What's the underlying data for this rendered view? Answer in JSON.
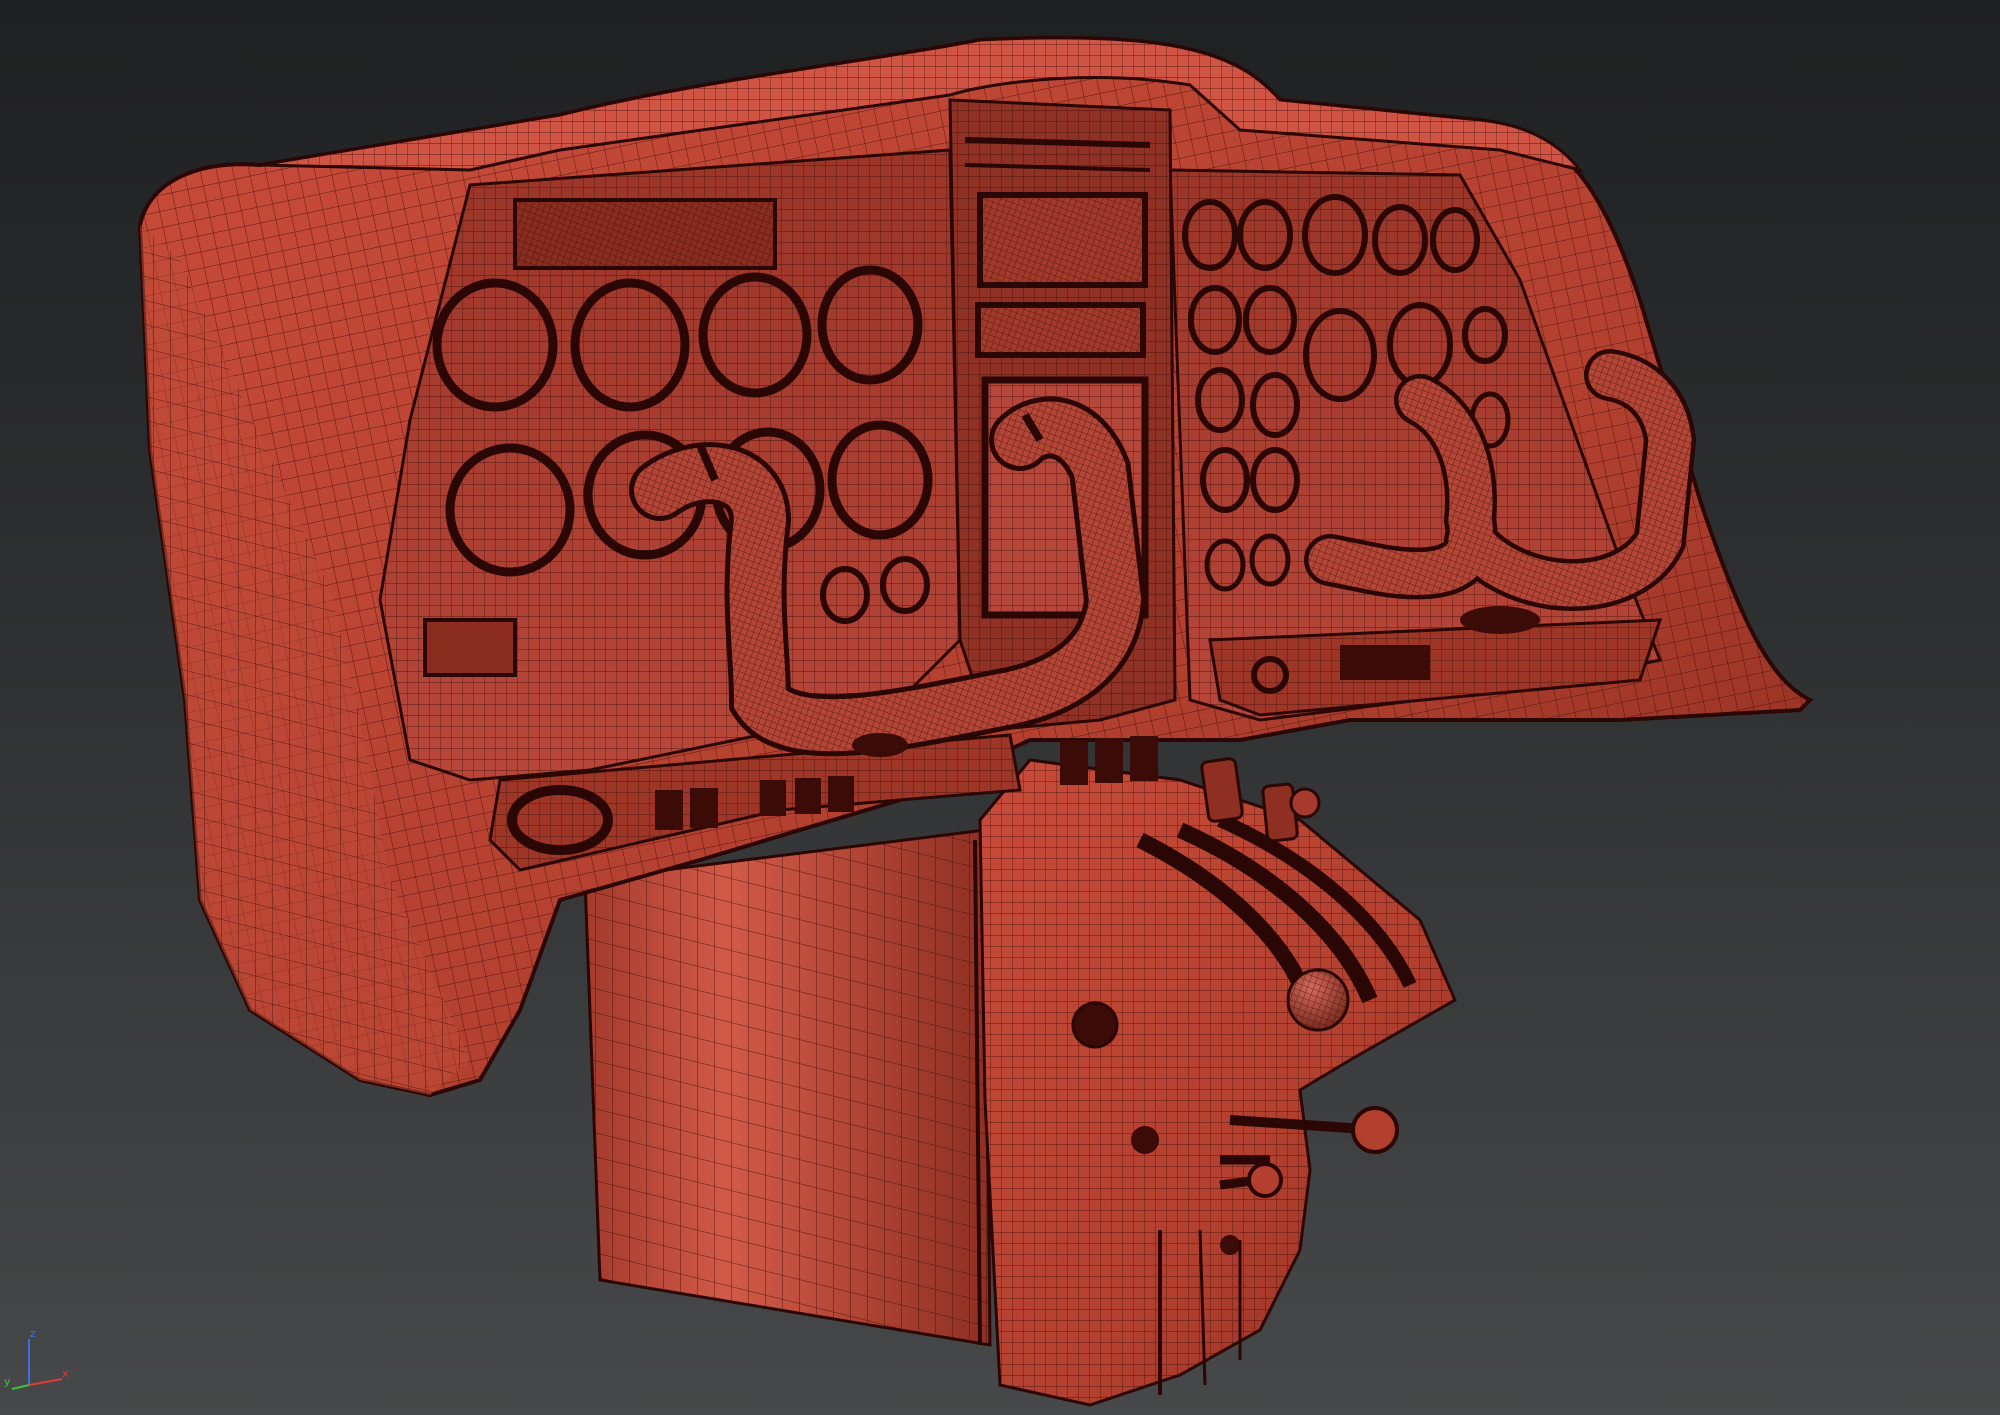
{
  "viewport": {
    "background_top": "#1f2021",
    "background_bottom": "#474849",
    "wire_color": "#3a0b07",
    "shade_light": "#cf5241",
    "shade_mid": "#a83a2b",
    "shade_dark": "#5c1a12",
    "object_icon": "cockpit-panel-wireframe-icon"
  },
  "axis_gizmo": {
    "x_label": "x",
    "y_label": "y",
    "z_label": "z",
    "x_color": "#e03b3b",
    "y_color": "#3fbf3f",
    "z_color": "#3c6fe0"
  }
}
